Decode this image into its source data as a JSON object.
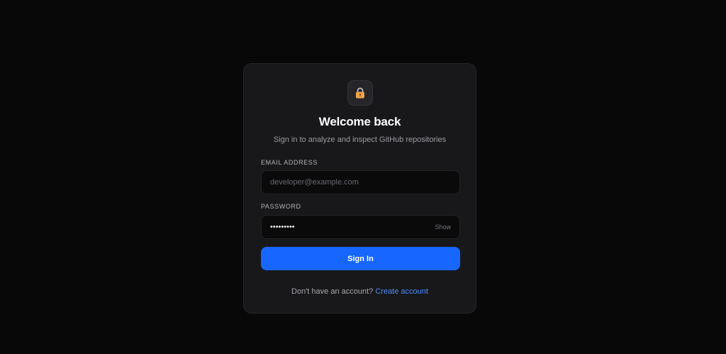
{
  "card": {
    "icon": "lock-icon",
    "title": "Welcome back",
    "subtitle": "Sign in to analyze and inspect GitHub repositories"
  },
  "email": {
    "label": "EMAIL ADDRESS",
    "placeholder": "developer@example.com",
    "value": ""
  },
  "password": {
    "label": "PASSWORD",
    "value": "password1",
    "toggle_label": "Show"
  },
  "actions": {
    "signin_label": "Sign In"
  },
  "footer": {
    "prompt": "Don't have an account?",
    "link_label": "Create account"
  },
  "colors": {
    "accent": "#1766ff",
    "link": "#4d8dff",
    "lock": "#f0a24a",
    "background": "#080808",
    "card": "#18181a"
  }
}
